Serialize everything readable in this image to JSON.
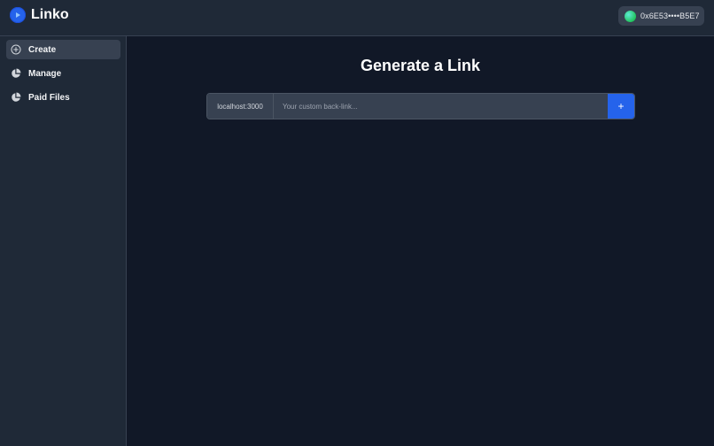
{
  "header": {
    "brand_name": "Linko",
    "logo_icon": "play-logo-icon",
    "wallet_address": "0x6E53••••B5E7"
  },
  "sidebar": {
    "items": [
      {
        "label": "Create",
        "icon": "plus-circle-icon",
        "active": true
      },
      {
        "label": "Manage",
        "icon": "pie-chart-icon",
        "active": false
      },
      {
        "label": "Paid Files",
        "icon": "pie-chart-icon",
        "active": false
      }
    ]
  },
  "main": {
    "title": "Generate a Link",
    "prefix": "localhost:3000",
    "input_value": "",
    "input_placeholder": "Your custom back-link...",
    "add_button_label": "+"
  },
  "colors": {
    "background": "#111827",
    "panel": "#1f2937",
    "input": "#374151",
    "accent": "#2563eb"
  }
}
